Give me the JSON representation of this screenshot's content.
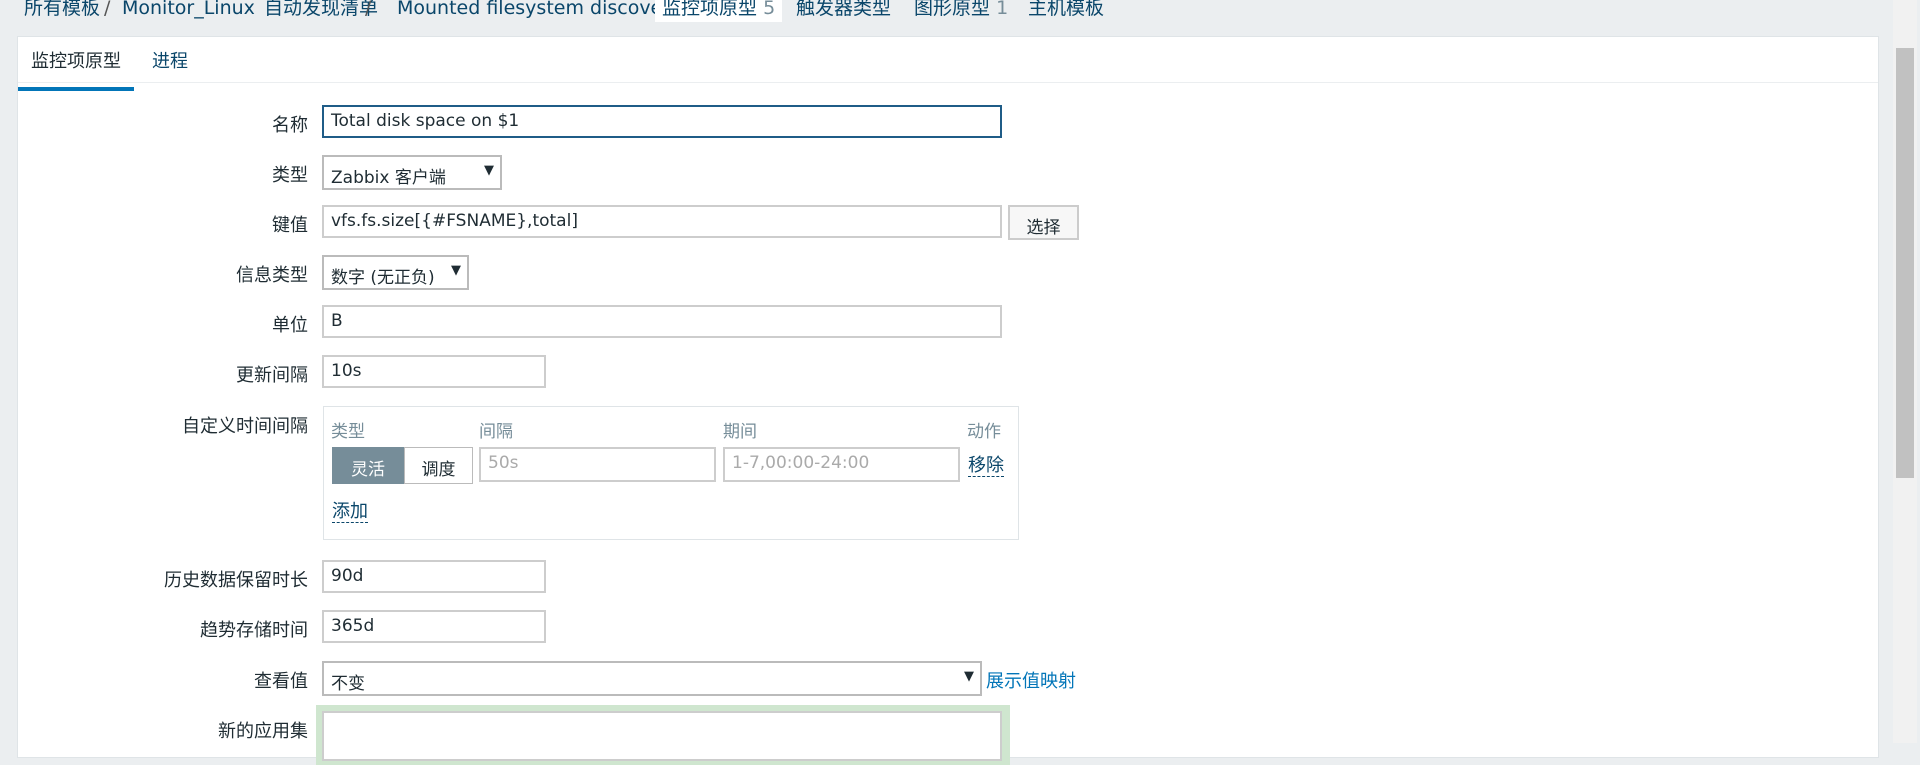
{
  "breadcrumbs": {
    "all_templates": "所有模板",
    "template": "Monitor_Linux",
    "discovery_list": "自动发现清单",
    "discovery_rule": "Mounted filesystem discovery",
    "item_prototypes": "监控项原型",
    "item_prototypes_count": "5",
    "trigger_types": "触发器类型",
    "graph_prototypes": "图形原型",
    "graph_prototypes_count": "1",
    "host_templates": "主机模板",
    "sep": "/"
  },
  "tabs": {
    "item_prototype": "监控项原型",
    "process": "进程"
  },
  "form": {
    "name_label": "名称",
    "name_value": "Total disk space on $1",
    "type_label": "类型",
    "type_value": "Zabbix 客户端",
    "key_label": "键值",
    "key_value": "vfs.fs.size[{#FSNAME},total]",
    "select_button": "选择",
    "info_type_label": "信息类型",
    "info_type_value": "数字 (无正负)",
    "units_label": "单位",
    "units_value": "B",
    "interval_label": "更新间隔",
    "interval_value": "10s",
    "custom_intervals_label": "自定义时间间隔",
    "history_label": "历史数据保留时长",
    "history_value": "90d",
    "trends_label": "趋势存储时间",
    "trends_value": "365d",
    "valuemap_label": "查看值",
    "valuemap_value": "不变",
    "show_valuemap_link": "展示值映射",
    "new_app_label": "新的应用集",
    "new_app_value": ""
  },
  "custom_intervals": {
    "col_type": "类型",
    "col_interval": "间隔",
    "col_period": "期间",
    "col_action": "动作",
    "toggle_flexible": "灵活",
    "toggle_scheduling": "调度",
    "interval_placeholder": "50s",
    "period_placeholder": "1-7,00:00-24:00",
    "remove_link": "移除",
    "add_link": "添加"
  },
  "colors": {
    "accent": "#0275b8",
    "link": "#0a466a",
    "toggle_active": "#768d99",
    "new_app_highlight": "#cfe6cf"
  },
  "icons": {
    "dropdown": "chevron-down-icon"
  }
}
